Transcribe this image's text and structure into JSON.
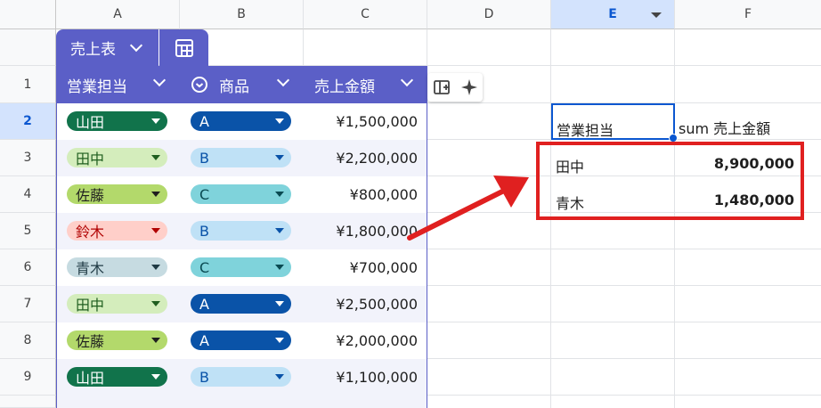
{
  "columns": [
    "A",
    "B",
    "C",
    "D",
    "E",
    "F"
  ],
  "rows": [
    "1",
    "2",
    "3",
    "4",
    "5",
    "6",
    "7",
    "8",
    "9"
  ],
  "table": {
    "name": "売上表",
    "headers": [
      "営業担当",
      "商品",
      "売上金額"
    ],
    "rows": [
      {
        "person": "山田",
        "product": "A",
        "amount": "¥1,500,000"
      },
      {
        "person": "田中",
        "product": "B",
        "amount": "¥2,200,000"
      },
      {
        "person": "佐藤",
        "product": "C",
        "amount": "¥800,000"
      },
      {
        "person": "鈴木",
        "product": "B",
        "amount": "¥1,800,000"
      },
      {
        "person": "青木",
        "product": "C",
        "amount": "¥700,000"
      },
      {
        "person": "田中",
        "product": "A",
        "amount": "¥2,500,000"
      },
      {
        "person": "佐藤",
        "product": "A",
        "amount": "¥2,000,000"
      },
      {
        "person": "山田",
        "product": "B",
        "amount": "¥1,100,000"
      }
    ]
  },
  "pivot": {
    "header_person": "営業担当",
    "header_sum": "sum 売上金額",
    "rows": [
      {
        "name": "田中",
        "total": "8,900,000"
      },
      {
        "name": "青木",
        "total": "1,480,000"
      }
    ]
  },
  "colors": {
    "header_purple": "#5b5fc7",
    "highlight_red": "#e02020",
    "selection_blue": "#0b57d0"
  },
  "chip_colors": {
    "山田": {
      "bg": "#11734b",
      "fg": "#ffffff",
      "arrow": "#ffffff"
    },
    "田中": {
      "bg": "#d4edbc",
      "fg": "#1f5e1f",
      "arrow": "#1f5e1f"
    },
    "佐藤": {
      "bg": "#b3d96b",
      "fg": "#1f1f1f",
      "arrow": "#1f1f1f"
    },
    "鈴木": {
      "bg": "#ffcfc9",
      "fg": "#b10202",
      "arrow": "#b10202"
    },
    "青木": {
      "bg": "#c6dbe1",
      "fg": "#1f3a44",
      "arrow": "#1f3a44"
    },
    "A": {
      "bg": "#0a53a8",
      "fg": "#ffffff",
      "arrow": "#ffffff"
    },
    "B": {
      "bg": "#bfe1f6",
      "fg": "#0a53a8",
      "arrow": "#0a53a8"
    },
    "C": {
      "bg": "#7fd3db",
      "fg": "#0a4a52",
      "arrow": "#0a4a52"
    }
  }
}
